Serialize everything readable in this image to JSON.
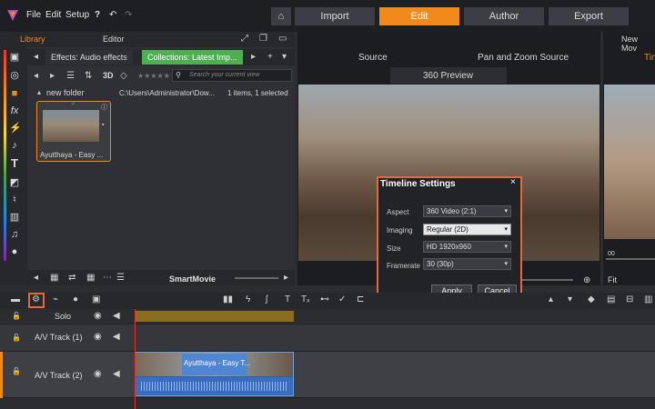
{
  "menubar": {
    "items": [
      "File",
      "Edit",
      "Setup",
      "?"
    ],
    "nav": [
      "Import",
      "Edit",
      "Author",
      "Export"
    ],
    "active_nav": "Edit"
  },
  "panels": {
    "library_tab": "Library",
    "editor_tab": "Editor",
    "tabs": [
      "Effects: Audio effects",
      "Collections: Latest Imp..."
    ],
    "search_placeholder": "Search your current view",
    "folder": "new folder",
    "path": "C:\\Users\\Administrator\\Dow...",
    "count": "1 items, 1 selected",
    "thumb_label": "Ayutthaya - Easy ...",
    "smartmovie": "SmartMovie",
    "view3d": "3D"
  },
  "player": {
    "source": "Source",
    "panzoom": "Pan and Zoom Source",
    "preview360": "360 Preview",
    "new_movie": "New Mov",
    "right_tab_partial": "Tin",
    "fit": "Fit",
    "timecode": "00"
  },
  "dialog": {
    "title": "Timeline Settings",
    "close": "×",
    "fields": [
      {
        "label": "Aspect",
        "value": "360 Video (2:1)"
      },
      {
        "label": "Imaging",
        "value": "Regular (2D)"
      },
      {
        "label": "Size",
        "value": "HD 1920x960"
      },
      {
        "label": "Framerate",
        "value": "30 (30p)"
      }
    ],
    "apply": "Apply",
    "cancel": "Cancel"
  },
  "timeline": {
    "tracks": [
      "Solo",
      "A/V Track (1)",
      "A/V Track (2)"
    ],
    "clip_title": "Ayutthaya - Easy T..."
  },
  "colors": {
    "accent": "#f08a1c",
    "highlight": "#e5683f",
    "clip": "#2f5da3"
  }
}
